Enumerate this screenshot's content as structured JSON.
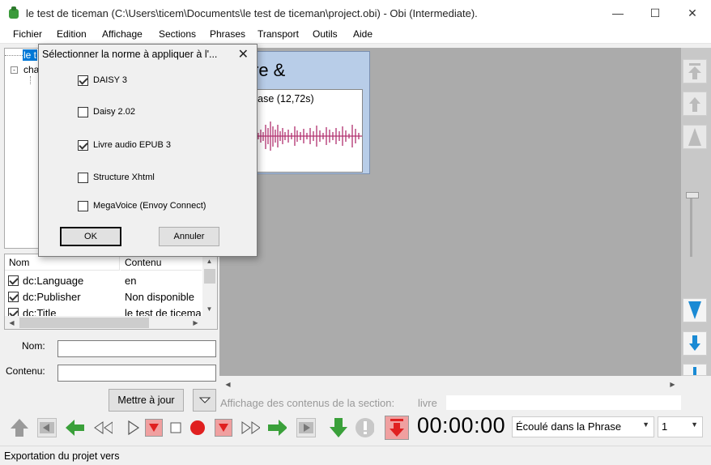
{
  "window": {
    "title": "le test de ticeman (C:\\Users\\ticem\\Documents\\le test de ticeman\\project.obi) - Obi (Intermediate).",
    "controls": [
      "minimize-icon",
      "maximize-icon",
      "close-icon"
    ]
  },
  "menu": [
    "Fichier",
    "Edition",
    "Affichage",
    "Sections",
    "Phrases",
    "Transport",
    "Outils",
    "Aide"
  ],
  "tree": {
    "root_label": "le t",
    "child_label": "cha"
  },
  "metadata": {
    "col_name": "Nom",
    "col_content": "Contenu",
    "rows": [
      {
        "name": "dc:Language",
        "value": "en",
        "checked": true
      },
      {
        "name": "dc:Publisher",
        "value": "Non disponible",
        "checked": true
      },
      {
        "name": "dc:Title",
        "value": "le test de ticema",
        "checked": true
      }
    ]
  },
  "form": {
    "name_label": "Nom:",
    "content_label": "Contenu:",
    "name_value": "",
    "content_value": "",
    "update_button": "Mettre à jour"
  },
  "content_view": {
    "strip_title": "re &",
    "phrase_label": "rase (12,72s)",
    "section_status_label": "Affichage des contenus de la section:",
    "section_status_value": "livre",
    "waveform_color": "#b0306e"
  },
  "transport": {
    "time": "00:00:00",
    "time_mode": "Écoulé dans la Phrase",
    "level": "1"
  },
  "statusbar": {
    "text": "Exportation du projet vers"
  },
  "dialog": {
    "title": "Sélectionner la norme à appliquer à l'...",
    "options": [
      {
        "label": "DAISY 3",
        "checked": true
      },
      {
        "label": "Daisy 2.02",
        "checked": false
      },
      {
        "label": "Livre audio EPUB 3",
        "checked": true
      },
      {
        "label": "Structure Xhtml",
        "checked": false
      },
      {
        "label": "MegaVoice (Envoy Connect)",
        "checked": false
      }
    ],
    "ok_label": "OK",
    "cancel_label": "Annuler"
  },
  "colors": {
    "accent_blue": "#1a8ad4",
    "record_red": "#e02020",
    "green_arrow": "#3aa03a",
    "strip_bg": "#b8cde8"
  }
}
